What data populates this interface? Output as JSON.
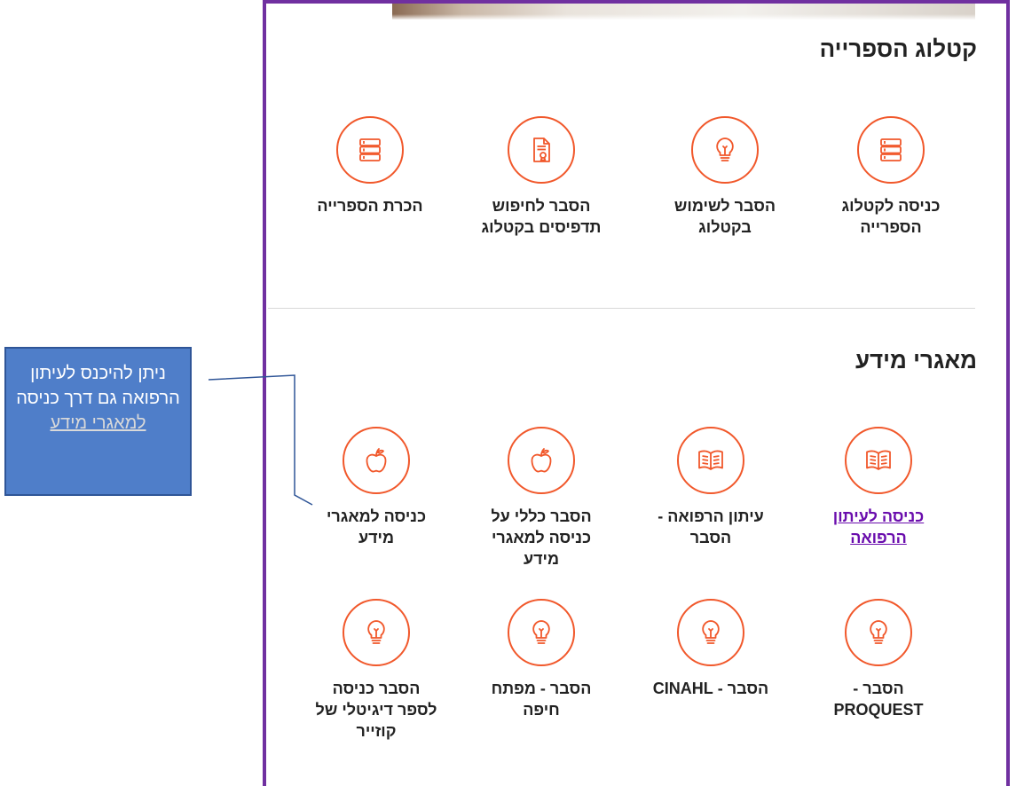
{
  "library_catalog": {
    "title": "קטלוג הספרייה",
    "items": [
      {
        "label": "כניסה לקטלוג הספרייה",
        "icon": "books-icon"
      },
      {
        "label": "הסבר לשימוש בקטלוג",
        "icon": "lightbulb-icon"
      },
      {
        "label": "הסבר לחיפוש תדפיסים בקטלוג",
        "icon": "document-certificate-icon"
      },
      {
        "label": "הכרת הספרייה",
        "icon": "books-icon"
      }
    ]
  },
  "databases": {
    "title": "מאגרי מידע",
    "items": [
      {
        "label": "כניסה לעיתון הרפואה",
        "icon": "open-book-icon",
        "link": true
      },
      {
        "label": "עיתון הרפואה - הסבר",
        "icon": "open-book-icon"
      },
      {
        "label": "הסבר כללי על כניסה למאגרי מידע",
        "icon": "apple-icon"
      },
      {
        "label": "כניסה למאגרי מידע",
        "icon": "apple-icon"
      },
      {
        "label": "הסבר - PROQUEST",
        "icon": "lightbulb-icon"
      },
      {
        "label": "הסבר - CINAHL",
        "icon": "lightbulb-icon"
      },
      {
        "label": "הסבר - מפתח חיפה",
        "icon": "lightbulb-icon"
      },
      {
        "label": "הסבר כניסה לספר דיגיטלי של קוזייר",
        "icon": "lightbulb-icon"
      }
    ]
  },
  "callout": {
    "text": "ניתן להיכנס לעיתון הרפואה גם דרך כניסה",
    "link_text": "למאגרי מידע"
  },
  "colors": {
    "accent": "#f1582b",
    "frame": "#7030a0",
    "callout_bg": "#4f7ec9",
    "link": "#6a0dad"
  }
}
